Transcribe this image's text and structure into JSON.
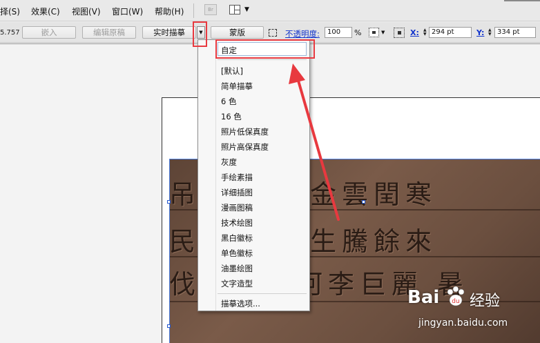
{
  "menubar": {
    "items": [
      {
        "label": "择(S)"
      },
      {
        "label": "效果(C)"
      },
      {
        "label": "视图(V)"
      },
      {
        "label": "窗口(W)"
      },
      {
        "label": "帮助(H)"
      }
    ],
    "bridge_icon": "Br",
    "layout_icon": "arrange-documents-icon"
  },
  "controlbar": {
    "stroke_value": "5.757",
    "embed_label": "嵌入",
    "edit_original_label": "编辑原稿",
    "live_trace_label": "实时描摹",
    "mask_label": "蒙版",
    "opacity_label": "不透明度:",
    "opacity_value": "100",
    "opacity_unit": "%",
    "x_label": "X:",
    "x_value": "294 pt",
    "y_label": "Y:",
    "y_value": "334 pt"
  },
  "trace_menu": {
    "selected": "自定",
    "items": [
      "[默认]",
      "简单描摹",
      "6 色",
      "16 色",
      "照片低保真度",
      "照片高保真度",
      "灰度",
      "手绘素描",
      "详细插图",
      "漫画图稿",
      "技术绘图",
      "黑白徽标",
      "单色徽标",
      "油墨绘图",
      "文字造型"
    ],
    "footer": "描摹选项..."
  },
  "photo_text": {
    "rows": [
      "吊  梅果劍金雲閏寒",
      "民  福珍號生騰餘來",
      "伐讓文夾河李巨麗  暑"
    ]
  },
  "watermark": {
    "brand": "Bai",
    "brand_suffix": "经验",
    "url": "jingyan.baidu.com"
  },
  "colors": {
    "highlight": "#e8393f",
    "link_blue": "#1133cc"
  }
}
